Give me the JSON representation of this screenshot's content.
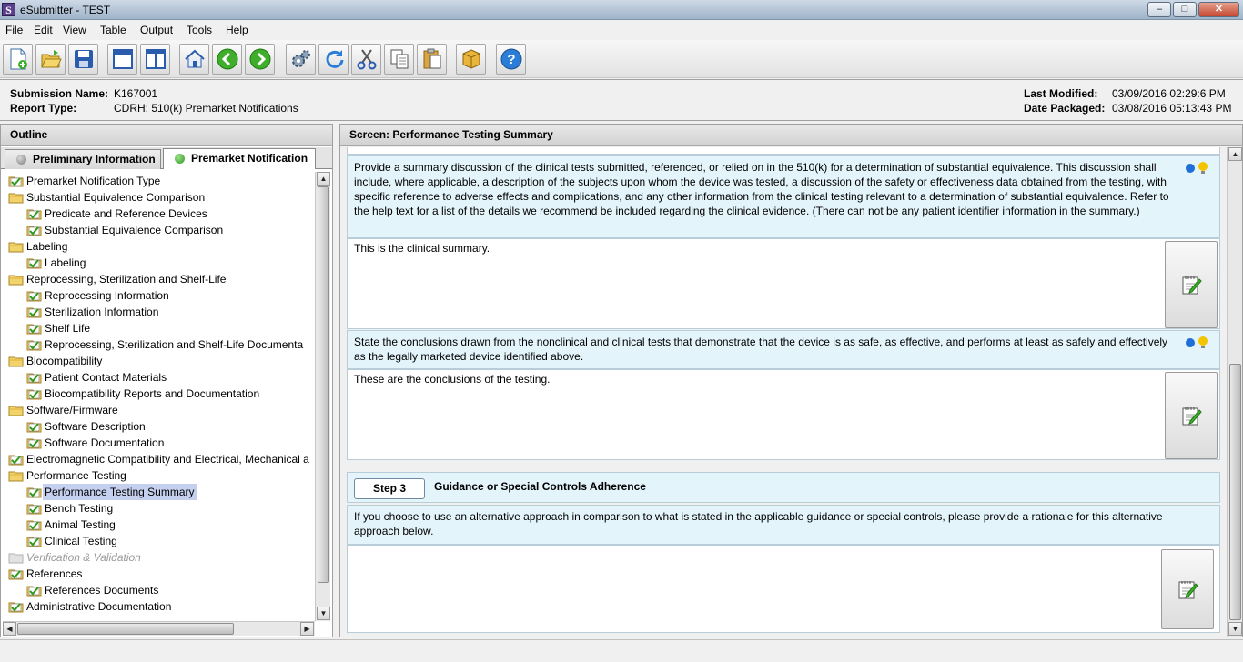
{
  "window": {
    "title": "eSubmitter - TEST",
    "app_letter": "S",
    "minimize": "–",
    "maximize": "□",
    "close": "✕"
  },
  "menu": [
    "File",
    "Edit",
    "View",
    "Table",
    "Output",
    "Tools",
    "Help"
  ],
  "toolbar": [
    "new-icon",
    "open-icon",
    "save-icon",
    "window-icon",
    "split-view-icon",
    "home-icon",
    "back-icon",
    "forward-icon",
    "settings-icon",
    "refresh-icon",
    "cut-icon",
    "copy-icon",
    "paste-icon",
    "package-icon",
    "help-icon"
  ],
  "info": {
    "submission_name_label": "Submission Name:",
    "submission_name": "K167001",
    "report_type_label": "Report Type:",
    "report_type": "CDRH: 510(k) Premarket Notifications",
    "last_modified_label": "Last Modified:",
    "last_modified": "03/09/2016 02:29:6 PM",
    "date_packaged_label": "Date Packaged:",
    "date_packaged": "03/08/2016 05:13:43 PM"
  },
  "outline": {
    "header": "Outline",
    "tabs": [
      {
        "label": "Preliminary Information",
        "dot": "#8a8a8a"
      },
      {
        "label": "Premarket Notification",
        "dot": "#3fae2a"
      }
    ],
    "items": [
      {
        "label": "Premarket Notification Type",
        "icon": "check",
        "level": 0
      },
      {
        "label": "Substantial Equivalence Comparison",
        "icon": "folder",
        "level": 0
      },
      {
        "label": "Predicate and Reference Devices",
        "icon": "check",
        "level": 1
      },
      {
        "label": "Substantial Equivalence Comparison",
        "icon": "check",
        "level": 1
      },
      {
        "label": "Labeling",
        "icon": "folder",
        "level": 0
      },
      {
        "label": "Labeling",
        "icon": "check",
        "level": 1
      },
      {
        "label": "Reprocessing, Sterilization and Shelf-Life",
        "icon": "folder",
        "level": 0
      },
      {
        "label": "Reprocessing Information",
        "icon": "check",
        "level": 1
      },
      {
        "label": "Sterilization Information",
        "icon": "check",
        "level": 1
      },
      {
        "label": "Shelf Life",
        "icon": "check",
        "level": 1
      },
      {
        "label": "Reprocessing, Sterilization and Shelf-Life Documenta",
        "icon": "check",
        "level": 1
      },
      {
        "label": "Biocompatibility",
        "icon": "folder",
        "level": 0
      },
      {
        "label": "Patient Contact Materials",
        "icon": "check",
        "level": 1
      },
      {
        "label": "Biocompatibility Reports and Documentation",
        "icon": "check",
        "level": 1
      },
      {
        "label": "Software/Firmware",
        "icon": "folder",
        "level": 0
      },
      {
        "label": "Software Description",
        "icon": "check",
        "level": 1
      },
      {
        "label": "Software Documentation",
        "icon": "check",
        "level": 1
      },
      {
        "label": "Electromagnetic Compatibility and Electrical, Mechanical a",
        "icon": "check",
        "level": 0
      },
      {
        "label": "Performance Testing",
        "icon": "folder",
        "level": 0
      },
      {
        "label": "Performance Testing Summary",
        "icon": "check",
        "level": 1,
        "selected": true
      },
      {
        "label": "Bench Testing",
        "icon": "check",
        "level": 1
      },
      {
        "label": "Animal Testing",
        "icon": "check",
        "level": 1
      },
      {
        "label": "Clinical Testing",
        "icon": "check",
        "level": 1
      },
      {
        "label": "Verification & Validation",
        "icon": "folder-gray",
        "level": 0,
        "disabled": true
      },
      {
        "label": "References",
        "icon": "check",
        "level": 0
      },
      {
        "label": "References Documents",
        "icon": "check",
        "level": 1
      },
      {
        "label": "Administrative Documentation",
        "icon": "check",
        "level": 0
      }
    ]
  },
  "screen": {
    "header": "Screen: Performance Testing Summary",
    "q1": "Provide a summary discussion of the clinical tests submitted, referenced, or relied on in the 510(k) for a determination of substantial equivalence. This discussion shall include, where applicable, a description of the subjects upon whom the device was tested, a discussion of the safety or effectiveness data obtained from the testing, with specific reference to adverse effects and complications, and any other information from the clinical testing relevant to a determination of substantial equivalence. Refer to the help text for a list of the details we recommend be included regarding the clinical evidence. (There can not be any patient identifier information in the summary.)",
    "a1": "This is the clinical summary.",
    "q2": "State the conclusions drawn from the nonclinical and clinical tests that demonstrate that the device is as safe, as effective, and performs at least as safely and effectively as the legally marketed device identified above.",
    "a2": "These are the conclusions of the testing.",
    "step_label": "Step 3",
    "step_title": "Guidance or Special Controls Adherence",
    "q3": "If you choose to use an alternative approach in comparison to what is stated in the applicable guidance or special controls, please provide a rationale for this alternative approach below.",
    "a3": ""
  },
  "colors": {
    "info_blue": "#1e6fd8",
    "hint_yellow": "#f2c500",
    "question_bg": "#e4f4fb",
    "selection": "#c4d0ee"
  }
}
